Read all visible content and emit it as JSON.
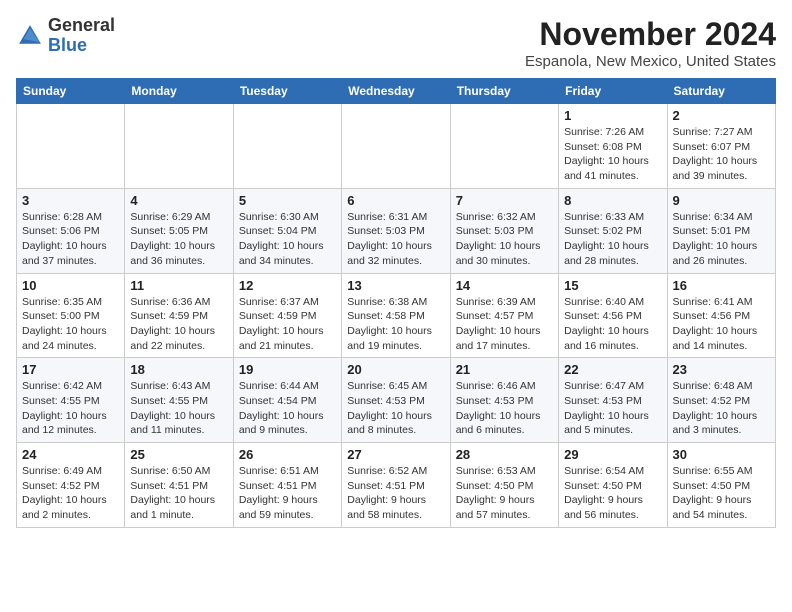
{
  "logo": {
    "general": "General",
    "blue": "Blue"
  },
  "header": {
    "month": "November 2024",
    "location": "Espanola, New Mexico, United States"
  },
  "weekdays": [
    "Sunday",
    "Monday",
    "Tuesday",
    "Wednesday",
    "Thursday",
    "Friday",
    "Saturday"
  ],
  "weeks": [
    [
      {
        "day": "",
        "info": ""
      },
      {
        "day": "",
        "info": ""
      },
      {
        "day": "",
        "info": ""
      },
      {
        "day": "",
        "info": ""
      },
      {
        "day": "",
        "info": ""
      },
      {
        "day": "1",
        "info": "Sunrise: 7:26 AM\nSunset: 6:08 PM\nDaylight: 10 hours\nand 41 minutes."
      },
      {
        "day": "2",
        "info": "Sunrise: 7:27 AM\nSunset: 6:07 PM\nDaylight: 10 hours\nand 39 minutes."
      }
    ],
    [
      {
        "day": "3",
        "info": "Sunrise: 6:28 AM\nSunset: 5:06 PM\nDaylight: 10 hours\nand 37 minutes."
      },
      {
        "day": "4",
        "info": "Sunrise: 6:29 AM\nSunset: 5:05 PM\nDaylight: 10 hours\nand 36 minutes."
      },
      {
        "day": "5",
        "info": "Sunrise: 6:30 AM\nSunset: 5:04 PM\nDaylight: 10 hours\nand 34 minutes."
      },
      {
        "day": "6",
        "info": "Sunrise: 6:31 AM\nSunset: 5:03 PM\nDaylight: 10 hours\nand 32 minutes."
      },
      {
        "day": "7",
        "info": "Sunrise: 6:32 AM\nSunset: 5:03 PM\nDaylight: 10 hours\nand 30 minutes."
      },
      {
        "day": "8",
        "info": "Sunrise: 6:33 AM\nSunset: 5:02 PM\nDaylight: 10 hours\nand 28 minutes."
      },
      {
        "day": "9",
        "info": "Sunrise: 6:34 AM\nSunset: 5:01 PM\nDaylight: 10 hours\nand 26 minutes."
      }
    ],
    [
      {
        "day": "10",
        "info": "Sunrise: 6:35 AM\nSunset: 5:00 PM\nDaylight: 10 hours\nand 24 minutes."
      },
      {
        "day": "11",
        "info": "Sunrise: 6:36 AM\nSunset: 4:59 PM\nDaylight: 10 hours\nand 22 minutes."
      },
      {
        "day": "12",
        "info": "Sunrise: 6:37 AM\nSunset: 4:59 PM\nDaylight: 10 hours\nand 21 minutes."
      },
      {
        "day": "13",
        "info": "Sunrise: 6:38 AM\nSunset: 4:58 PM\nDaylight: 10 hours\nand 19 minutes."
      },
      {
        "day": "14",
        "info": "Sunrise: 6:39 AM\nSunset: 4:57 PM\nDaylight: 10 hours\nand 17 minutes."
      },
      {
        "day": "15",
        "info": "Sunrise: 6:40 AM\nSunset: 4:56 PM\nDaylight: 10 hours\nand 16 minutes."
      },
      {
        "day": "16",
        "info": "Sunrise: 6:41 AM\nSunset: 4:56 PM\nDaylight: 10 hours\nand 14 minutes."
      }
    ],
    [
      {
        "day": "17",
        "info": "Sunrise: 6:42 AM\nSunset: 4:55 PM\nDaylight: 10 hours\nand 12 minutes."
      },
      {
        "day": "18",
        "info": "Sunrise: 6:43 AM\nSunset: 4:55 PM\nDaylight: 10 hours\nand 11 minutes."
      },
      {
        "day": "19",
        "info": "Sunrise: 6:44 AM\nSunset: 4:54 PM\nDaylight: 10 hours\nand 9 minutes."
      },
      {
        "day": "20",
        "info": "Sunrise: 6:45 AM\nSunset: 4:53 PM\nDaylight: 10 hours\nand 8 minutes."
      },
      {
        "day": "21",
        "info": "Sunrise: 6:46 AM\nSunset: 4:53 PM\nDaylight: 10 hours\nand 6 minutes."
      },
      {
        "day": "22",
        "info": "Sunrise: 6:47 AM\nSunset: 4:53 PM\nDaylight: 10 hours\nand 5 minutes."
      },
      {
        "day": "23",
        "info": "Sunrise: 6:48 AM\nSunset: 4:52 PM\nDaylight: 10 hours\nand 3 minutes."
      }
    ],
    [
      {
        "day": "24",
        "info": "Sunrise: 6:49 AM\nSunset: 4:52 PM\nDaylight: 10 hours\nand 2 minutes."
      },
      {
        "day": "25",
        "info": "Sunrise: 6:50 AM\nSunset: 4:51 PM\nDaylight: 10 hours\nand 1 minute."
      },
      {
        "day": "26",
        "info": "Sunrise: 6:51 AM\nSunset: 4:51 PM\nDaylight: 9 hours\nand 59 minutes."
      },
      {
        "day": "27",
        "info": "Sunrise: 6:52 AM\nSunset: 4:51 PM\nDaylight: 9 hours\nand 58 minutes."
      },
      {
        "day": "28",
        "info": "Sunrise: 6:53 AM\nSunset: 4:50 PM\nDaylight: 9 hours\nand 57 minutes."
      },
      {
        "day": "29",
        "info": "Sunrise: 6:54 AM\nSunset: 4:50 PM\nDaylight: 9 hours\nand 56 minutes."
      },
      {
        "day": "30",
        "info": "Sunrise: 6:55 AM\nSunset: 4:50 PM\nDaylight: 9 hours\nand 54 minutes."
      }
    ]
  ]
}
